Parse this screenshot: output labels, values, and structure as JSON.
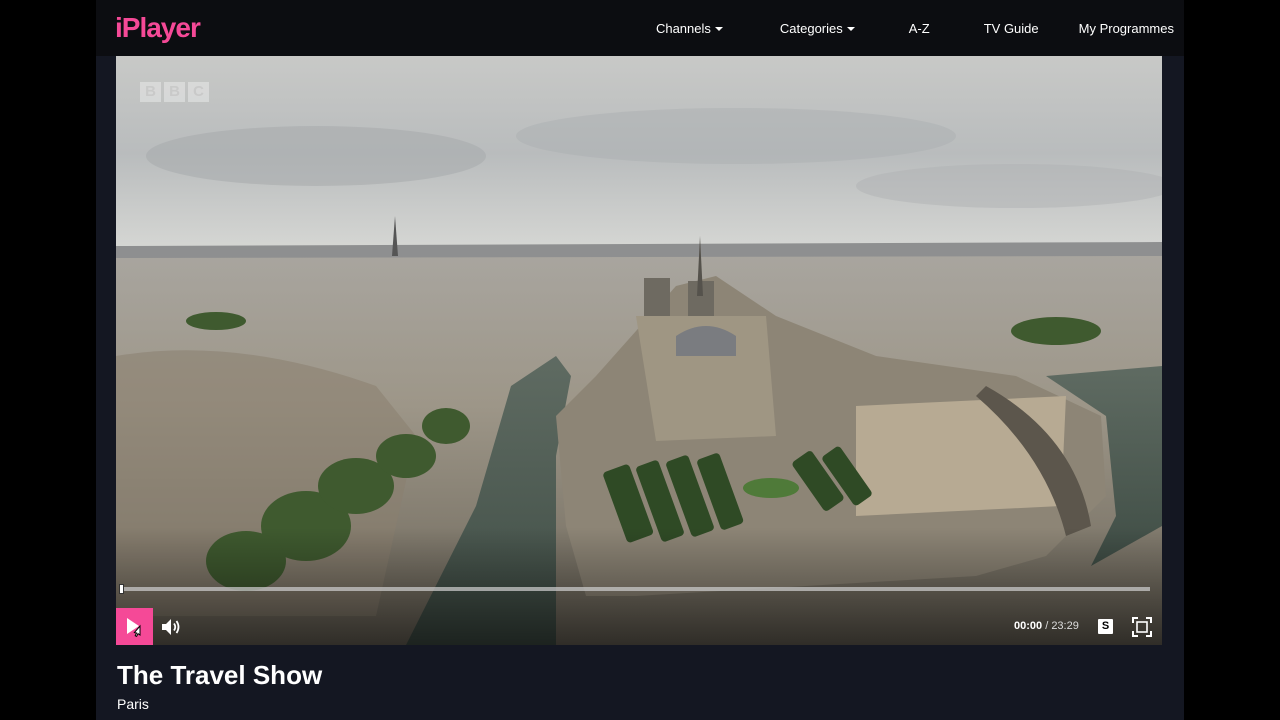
{
  "header": {
    "logo": "iPlayer",
    "nav": [
      {
        "label": "Channels",
        "dropdown": true
      },
      {
        "label": "Categories",
        "dropdown": true
      },
      {
        "label": "A-Z",
        "dropdown": false
      },
      {
        "label": "TV Guide",
        "dropdown": false
      },
      {
        "label": "My Programmes",
        "dropdown": false
      }
    ]
  },
  "player": {
    "watermark": [
      "B",
      "B",
      "C"
    ],
    "progress": 0.0,
    "current_time": "00:00",
    "separator": " / ",
    "duration": "23:29",
    "subtitles_label": "S",
    "state": "paused"
  },
  "programme": {
    "title": "The Travel Show",
    "episode": "Paris"
  },
  "colors": {
    "brand": "#f54997",
    "background": "#141722",
    "header": "#0c0d11"
  },
  "icons": {
    "play": "play-icon",
    "volume": "volume-icon",
    "fullscreen": "fullscreen-icon",
    "cursor": "hand-cursor-icon"
  }
}
